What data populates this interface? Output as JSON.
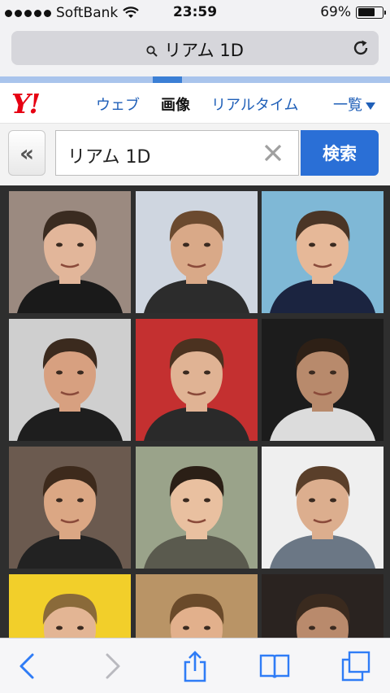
{
  "status": {
    "carrier": "SoftBank",
    "time": "23:59",
    "battery": "69%",
    "battery_level": 0.69
  },
  "browser": {
    "url_text": "リアム 1D",
    "load_progress": 1.0
  },
  "yahoo": {
    "logo": "Y!",
    "tabs": [
      {
        "label": "ウェブ",
        "active": false
      },
      {
        "label": "画像",
        "active": true
      },
      {
        "label": "リアルタイム",
        "active": false
      }
    ],
    "more_label": "一覧"
  },
  "search": {
    "back_label": "«",
    "query": "リアム 1D",
    "button_label": "検索"
  },
  "results": {
    "images": [
      {
        "desc": "portrait",
        "bg": "#9b8a80",
        "skin": "#e2b69a",
        "hair": "#3a2b20",
        "shirt": "#1a1a1a"
      },
      {
        "desc": "event",
        "bg": "#cfd6e0",
        "skin": "#d9a988",
        "hair": "#6b4a2f",
        "shirt": "#2c2c2c"
      },
      {
        "desc": "couple",
        "bg": "#7fb8d6",
        "skin": "#e6b898",
        "hair": "#4a3526",
        "shirt": "#1b2440"
      },
      {
        "desc": "portrait",
        "bg": "#cfcfcf",
        "skin": "#d7a080",
        "hair": "#3b2a1e",
        "shirt": "#1e1e1e"
      },
      {
        "desc": "portrait",
        "bg": "#c43030",
        "skin": "#e0b394",
        "hair": "#4b3220",
        "shirt": "#2a2a2a"
      },
      {
        "desc": "portrait",
        "bg": "#1c1c1c",
        "skin": "#b88a6c",
        "hair": "#2e2016",
        "shirt": "#dcdcdc"
      },
      {
        "desc": "portrait",
        "bg": "#6b5a4f",
        "skin": "#dba784",
        "hair": "#3d2a1c",
        "shirt": "#222222"
      },
      {
        "desc": "selfie",
        "bg": "#9aa38a",
        "skin": "#e9c0a0",
        "hair": "#2b1f16",
        "shirt": "#5a5a4e"
      },
      {
        "desc": "fullbody",
        "bg": "#efefef",
        "skin": "#dcae8e",
        "hair": "#5a3f2a",
        "shirt": "#6b7785"
      },
      {
        "desc": "magazine",
        "bg": "#f2cf2a",
        "skin": "#e3b594",
        "hair": "#8a6a3a",
        "shirt": "#3a3a3a"
      },
      {
        "desc": "portrait",
        "bg": "#b99466",
        "skin": "#e2b08c",
        "hair": "#6a4a2a",
        "shirt": "#3a2c20"
      },
      {
        "desc": "portrait",
        "bg": "#2a2320",
        "skin": "#b98a6c",
        "hair": "#3a2a1e",
        "shirt": "#2a2320"
      }
    ]
  },
  "colors": {
    "yahoo_red": "#e60012",
    "link_blue": "#1f5fb8",
    "search_blue": "#2a6fd6"
  },
  "toolbar": {
    "icons": [
      "back-icon",
      "forward-icon",
      "share-icon",
      "bookmarks-icon",
      "tabs-icon"
    ]
  }
}
